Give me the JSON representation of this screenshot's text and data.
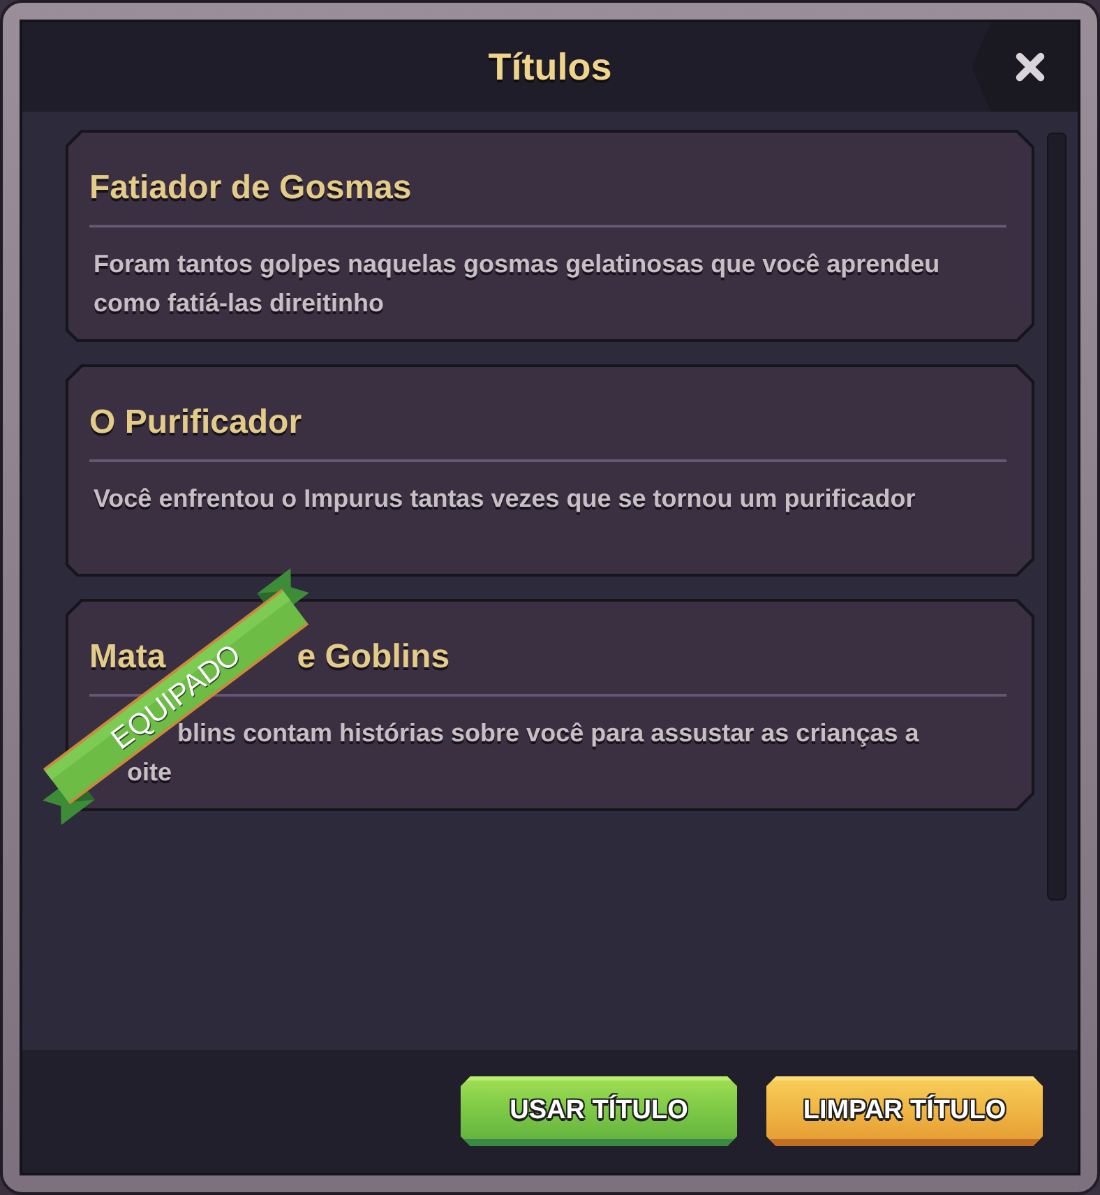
{
  "window": {
    "title": "Títulos"
  },
  "titles": [
    {
      "name": "Fatiador de Gosmas",
      "description": "Foram tantos golpes naquelas gosmas gelatinosas que você aprendeu como fatiá-las direitinho",
      "equipped": false
    },
    {
      "name": "O Purificador",
      "description": "Você enfrentou o Impurus tantas vezes que se tornou um purificador",
      "equipped": false
    },
    {
      "name": "Mata",
      "name_after_ribbon": "e Goblins",
      "description": "blins contam histórias sobre você para assustar as crianças a",
      "description_next_line": "oite",
      "equipped": true,
      "ribbon": "EQUIPADO"
    }
  ],
  "buttons": [
    {
      "label": "USAR TÍTULO",
      "kind": "use"
    },
    {
      "label": "LIMPAR TÍTULO",
      "kind": "clear"
    }
  ]
}
